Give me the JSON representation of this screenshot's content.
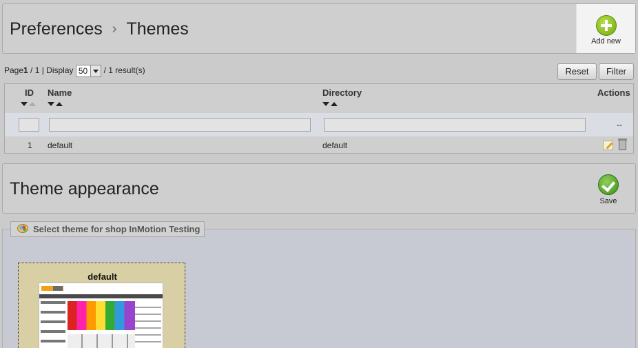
{
  "breadcrumb": {
    "parent": "Preferences",
    "separator": "›",
    "current": "Themes"
  },
  "toolbar": {
    "add_new_label": "Add new"
  },
  "pagination": {
    "page_label": "Page",
    "current_page": "1",
    "total_pages_text": " / 1 | Display",
    "per_page": "50",
    "results_text": "/ 1 result(s)"
  },
  "list_actions": {
    "reset_label": "Reset",
    "filter_label": "Filter"
  },
  "table": {
    "columns": {
      "id": "ID",
      "name": "Name",
      "directory": "Directory",
      "actions": "Actions"
    },
    "filter_row": {
      "id_value": "",
      "name_value": "",
      "directory_value": "",
      "actions_placeholder": "--"
    },
    "rows": [
      {
        "id": "1",
        "name": "default",
        "directory": "default"
      }
    ]
  },
  "appearance": {
    "title": "Theme appearance",
    "save_label": "Save"
  },
  "theme_select": {
    "legend": "Select theme for shop InMotion Testing",
    "themes": [
      {
        "name": "default"
      }
    ]
  },
  "colors": {
    "add_icon": "#8cc21a",
    "save_icon": "#5aab2c"
  }
}
